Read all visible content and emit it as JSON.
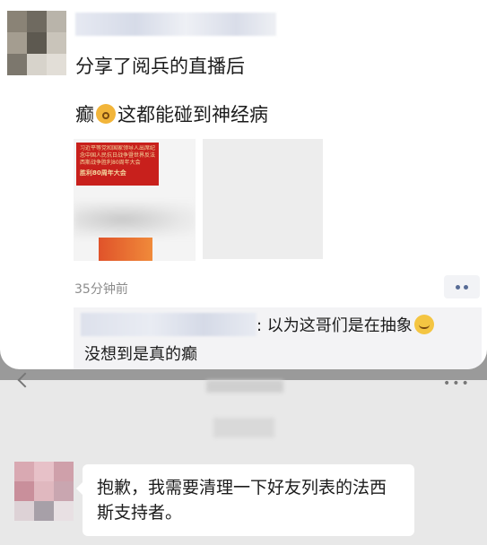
{
  "moments": {
    "post_text": "分享了阅兵的直播后",
    "post_comment_prefix": "癫",
    "post_comment_suffix": "这都能碰到神经病",
    "shared_card": {
      "headline": "习近平等党和国家领导人出席纪念中国人民抗日战争暨世界反法西斯战争胜利80周年大会",
      "title": "胜利80周年大会"
    },
    "timestamp": "35分钟前",
    "comment": {
      "text_line1": ": 以为这哥们是在抽象",
      "text_line2": "没想到是真的癫"
    }
  },
  "chat": {
    "message": "抱歉，我需要清理一下好友列表的法西斯支持者。"
  },
  "icons": {
    "emoji_1": "dizzy-face-emoji",
    "emoji_2": "smirk-emoji",
    "more": "more-dots-icon",
    "back": "chevron-left-icon"
  },
  "colors": {
    "link_blue": "#576b95",
    "comment_bg": "#f3f3f5",
    "chat_bg": "#e8e8e8"
  }
}
